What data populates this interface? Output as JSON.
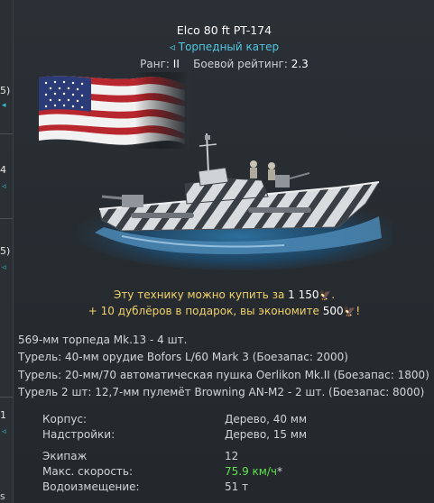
{
  "background_list": {
    "items": [
      {
        "text": "5)",
        "mark": "◂"
      },
      {
        "text": "4",
        "mark": "◃"
      },
      {
        "text": "5)",
        "mark": "◃"
      },
      {
        "text": "1",
        "mark": "◃"
      }
    ],
    "bottom_fragment": "s"
  },
  "vehicle": {
    "name": "Elco 80 ft PT-174",
    "class_icon": "◃",
    "class_label": "Торпедный катер",
    "rank_label": "Ранг:",
    "rank_value": "II",
    "battle_rating_label": "Боевой рейтинг:",
    "battle_rating_value": "2.3",
    "flag_icon": "usa-flag-icon",
    "image_icon": "pt-boat-image"
  },
  "offer": {
    "line1_prefix": "Эту технику можно купить за",
    "price": "1 150",
    "line2_prefix": "+ 10 дублёров в подарок, вы экономите",
    "savings": "500",
    "currency_icon": "golden-eagle-icon",
    "currency_glyph": "🦅",
    "line2_suffix": "!"
  },
  "weapons": [
    "569-мм торпеда Mk.13 - 4 шт.",
    "Турель: 40-мм орудие Bofors L/60 Mark 3 (Боезапас: 2000)",
    "Турель: 20-мм/70 автоматическая пушка Oerlikon Mk.II (Боезапас: 1800)",
    "Турель 2 шт: 12,7-мм пулемёт Browning AN-M2 - 2 шт. (Боезапас: 8000)"
  ],
  "stats": {
    "hull_label": "Корпус:",
    "hull_value": "Дерево, 40 мм",
    "superstructure_label": "Надстройки:",
    "superstructure_value": "Дерево, 15 мм",
    "crew_label": "Экипаж",
    "crew_value": "12",
    "speed_label": "Макс. скорость:",
    "speed_value": "75.9 км/ч",
    "speed_suffix": "*",
    "displacement_label": "Водоизмещение:",
    "displacement_value": "51 т"
  },
  "colors": {
    "accent_cyan": "#52c6e0",
    "gold": "#f0d26a",
    "speed_green": "#5fe24b"
  }
}
